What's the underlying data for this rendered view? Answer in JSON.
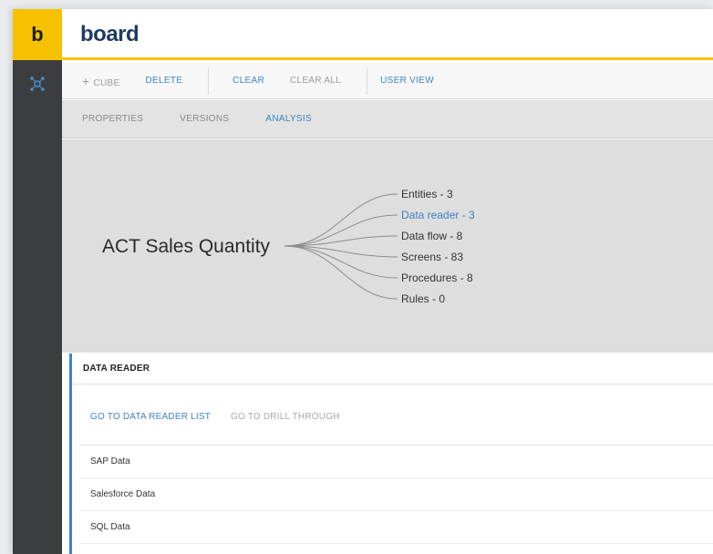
{
  "header": {
    "logo_letter": "b",
    "brand": "board"
  },
  "toolbar": {
    "cube": "CUBE",
    "delete": "DELETE",
    "clear": "CLEAR",
    "clear_all": "CLEAR ALL",
    "user_view": "USER VIEW"
  },
  "tabs": [
    "PROPERTIES",
    "VERSIONS",
    "ANALYSIS"
  ],
  "active_tab": "ANALYSIS",
  "analysis": {
    "entity": "ACT Sales Quantity",
    "branches": [
      {
        "label": "Entities - 3",
        "active": false
      },
      {
        "label": "Data reader - 3",
        "active": true
      },
      {
        "label": "Data flow - 8",
        "active": false
      },
      {
        "label": "Screens - 83",
        "active": false
      },
      {
        "label": "Procedures - 8",
        "active": false
      },
      {
        "label": "Rules - 0",
        "active": false
      }
    ]
  },
  "panel": {
    "title": "DATA READER",
    "link_primary": "GO TO DATA READER LIST",
    "link_secondary": "GO TO DRILL THROUGH",
    "items": [
      "SAP Data",
      "Salesforce Data",
      "SQL Data"
    ]
  },
  "colors": {
    "accent_yellow": "#f6c200",
    "link_blue": "#3d84c6",
    "rail": "#3b3d3f"
  }
}
